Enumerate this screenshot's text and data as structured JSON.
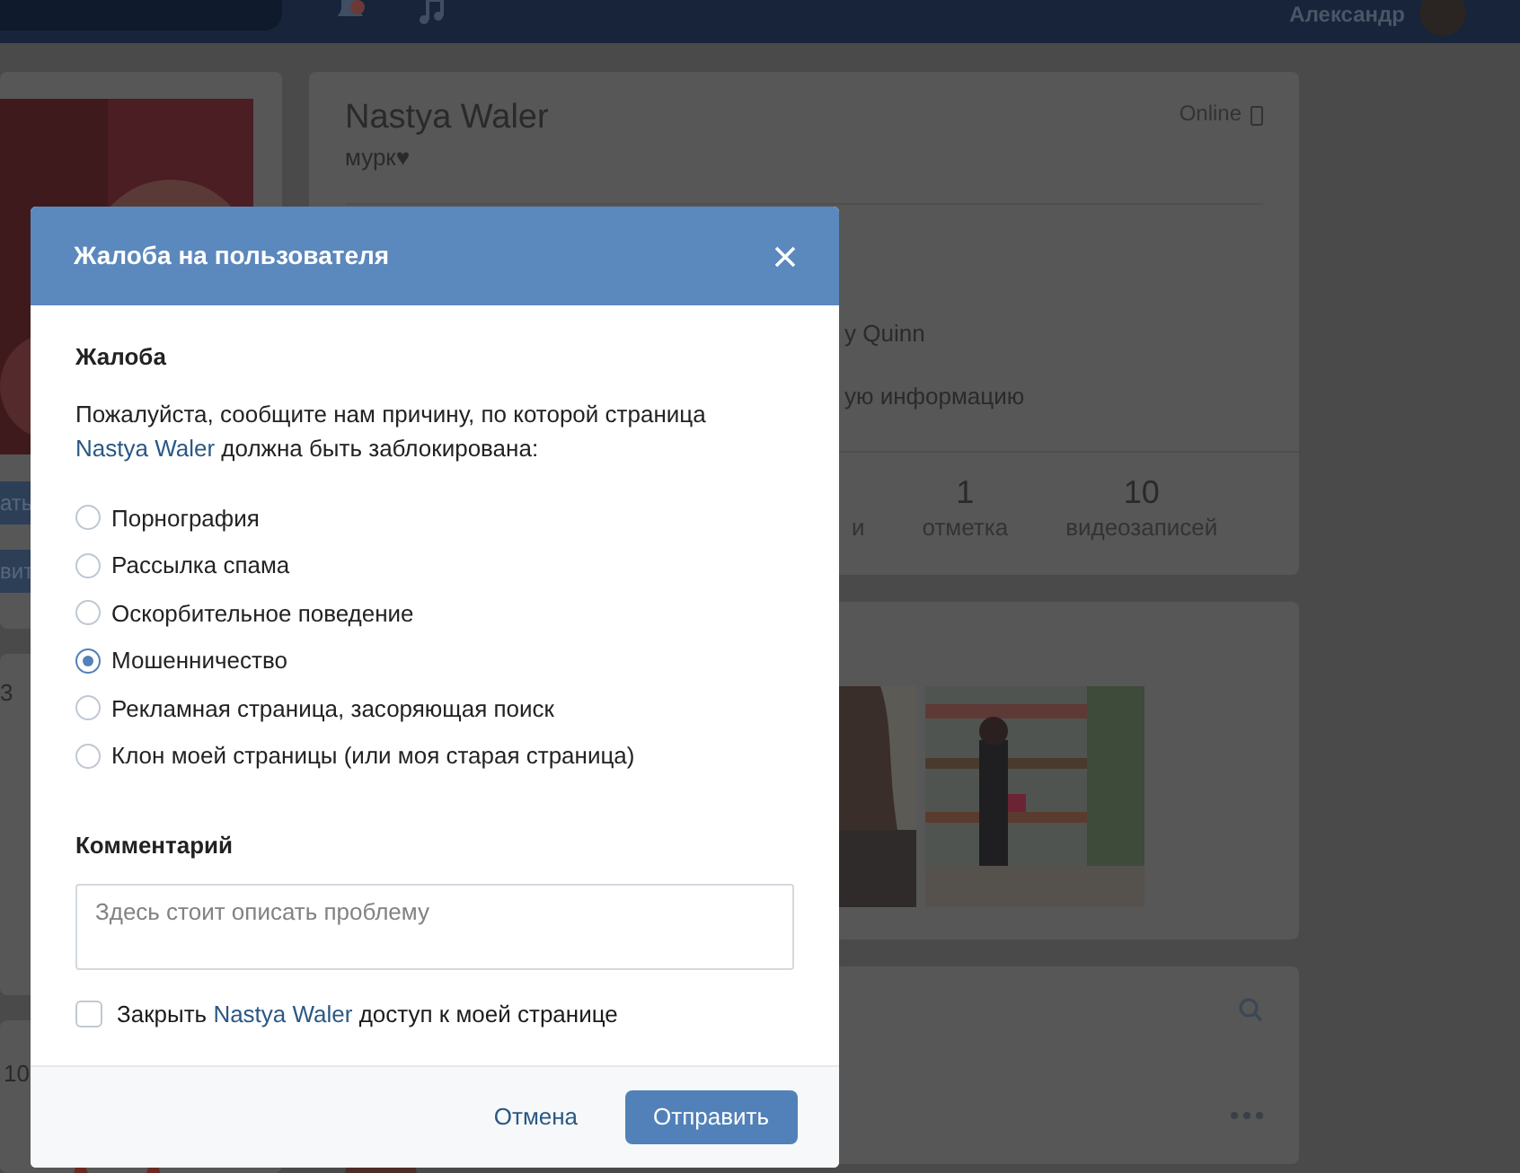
{
  "header": {
    "user_name": "Александр"
  },
  "sidebar": {
    "buttons": [
      "ать",
      "вит"
    ],
    "numbers": [
      "3",
      "10"
    ]
  },
  "profile": {
    "name": "Nastya Waler",
    "status": "мурк♥",
    "online": "Online",
    "info_lines": [
      "y Quinn",
      "ую информацию"
    ],
    "counters": [
      {
        "label": "и"
      },
      {
        "value": "1",
        "label": "отметка"
      },
      {
        "value": "10",
        "label": "видеозаписей"
      }
    ]
  },
  "dialog": {
    "title": "Жалоба на пользователя",
    "section_label": "Жалоба",
    "message": {
      "before": "Пожалуйста, сообщите нам причину, по которой страница ",
      "link": "Nastya Waler",
      "after": " должна быть заблокирована:"
    },
    "reasons": [
      {
        "label": "Порнография",
        "selected": false
      },
      {
        "label": "Рассылка спама",
        "selected": false
      },
      {
        "label": "Оскорбительное поведение",
        "selected": false
      },
      {
        "label": "Мошенничество",
        "selected": true
      },
      {
        "label": "Рекламная страница, засоряющая поиск",
        "selected": false
      },
      {
        "label": "Клон моей страницы (или моя старая страница)",
        "selected": false
      }
    ],
    "comment_label": "Комментарий",
    "comment_placeholder": "Здесь стоит описать проблему",
    "block_option": {
      "before": "Закрыть ",
      "link": "Nastya Waler",
      "after": " доступ к моей странице",
      "checked": false
    },
    "cancel_button": "Отмена",
    "submit_button": "Отправить"
  }
}
